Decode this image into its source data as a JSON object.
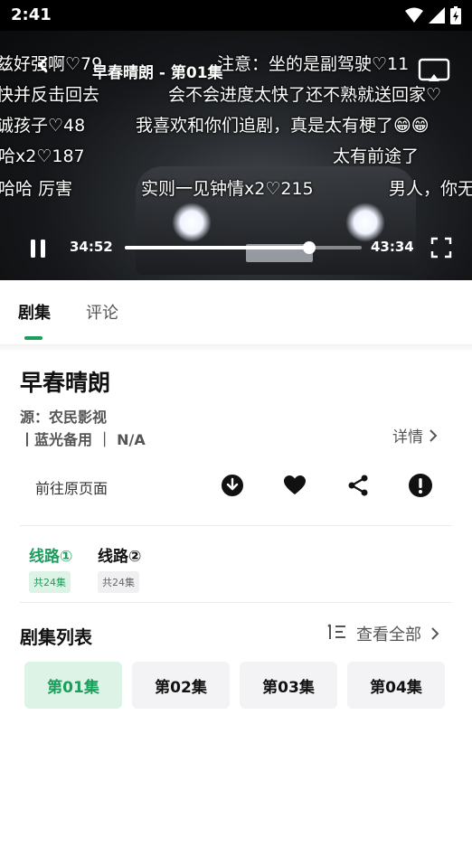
{
  "status_bar": {
    "time": "2:41"
  },
  "player": {
    "title": "早春晴朗 - 第01集",
    "current_time": "34:52",
    "total_time": "43:34",
    "progress": 0.78,
    "danmaku": [
      {
        "text": "兹好强啊♡79",
        "row": 1,
        "start": -4
      },
      {
        "text": "注意：坐的是副驾驶♡11",
        "row": 1,
        "start": 240
      },
      {
        "text": "快并反击回去",
        "row": 2,
        "start": -4
      },
      {
        "text": "会不会进度太快了还不熟就送回家♡",
        "row": 2,
        "start": 186
      },
      {
        "text": "诚孩子♡48",
        "row": 3,
        "start": -4
      },
      {
        "text": "我喜欢和你们追剧，真是太有梗了😁😁",
        "row": 3,
        "start": 150
      },
      {
        "text": "哈x2♡187",
        "row": 4,
        "start": -2
      },
      {
        "text": "太有前途了",
        "row": 4,
        "start": 368
      },
      {
        "text": "哈哈 厉害",
        "row": 5,
        "start": -2
      },
      {
        "text": "实则一见钟情x2♡215",
        "row": 5,
        "start": 156
      },
      {
        "text": "男人，你无",
        "row": 5,
        "start": 430
      }
    ]
  },
  "tabs": [
    {
      "label": "剧集",
      "active": true
    },
    {
      "label": "评论",
      "active": false
    }
  ],
  "drama": {
    "title": "早春晴朗",
    "source": "源：农民影视",
    "lines": "丨蓝光备用 ｜ N/A",
    "detail_label": "详情"
  },
  "actions": {
    "goto_label": "前往原页面",
    "icons": [
      "download-icon",
      "heart-icon",
      "share-icon",
      "report-icon"
    ]
  },
  "routes": [
    {
      "name": "线路①",
      "count": "共24集",
      "active": true
    },
    {
      "name": "线路②",
      "count": "共24集",
      "active": false
    }
  ],
  "episode_list": {
    "title": "剧集列表",
    "view_all_label": "查看全部",
    "episodes": [
      {
        "label": "第01集",
        "active": true
      },
      {
        "label": "第02集",
        "active": false
      },
      {
        "label": "第03集",
        "active": false
      },
      {
        "label": "第04集",
        "active": false
      }
    ]
  },
  "colors": {
    "accent": "#1a9e5b",
    "accent_bg": "#dcf3e6"
  }
}
